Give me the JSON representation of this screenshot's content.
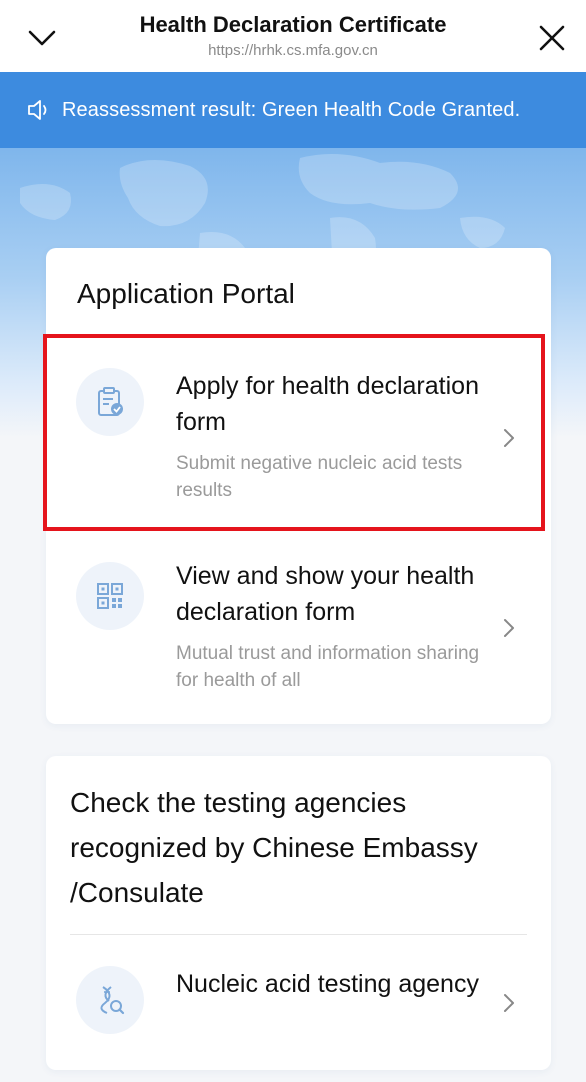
{
  "header": {
    "title": "Health Declaration Certificate",
    "url": "https://hrhk.cs.mfa.gov.cn"
  },
  "notice": {
    "text": "Reassessment result: Green Health Code Granted."
  },
  "portal": {
    "title": "Application Portal",
    "items": [
      {
        "title": "Apply for health declaration form",
        "subtitle": "Submit negative nucleic acid tests results",
        "icon": "clipboard-check-icon"
      },
      {
        "title": "View and show your health declaration form",
        "subtitle": "Mutual trust and information sharing for health of all",
        "icon": "qr-code-icon"
      }
    ]
  },
  "agencies": {
    "title": "Check the testing agencies recognized by Chinese Embassy /Consulate",
    "items": [
      {
        "title": "Nucleic acid testing agency",
        "icon": "dna-search-icon"
      }
    ]
  },
  "colors": {
    "accent": "#3d8bdf",
    "highlight": "#e5141c",
    "icon": "#7aa7d8"
  }
}
